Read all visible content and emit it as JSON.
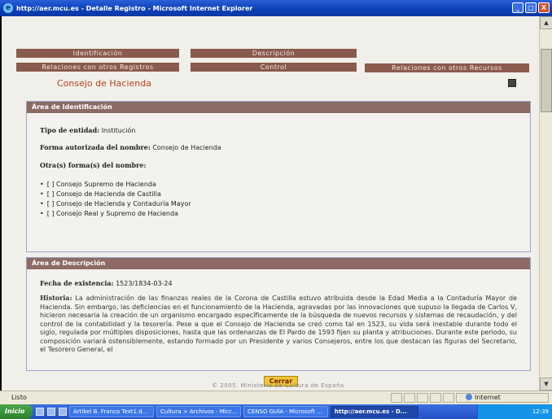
{
  "window": {
    "title": "http://aer.mcu.es - Detalle Registro - Microsoft Internet Explorer",
    "buttons": [
      "_",
      "□",
      "X"
    ]
  },
  "tabs": {
    "identificacion": "Identificación",
    "descripcion": "Descripción",
    "relaciones_registros": "Relaciones con otros Registros",
    "control": "Control",
    "relaciones_recursos": "Relaciones con otros Recursos"
  },
  "page_title": "Consejo de Hacienda",
  "identificacion": {
    "heading": "Área de Identificación",
    "tipo_label": "Tipo de entidad:",
    "tipo_value": "Institución",
    "forma_label": "Forma autorizada del nombre:",
    "forma_value": "Consejo de Hacienda",
    "otras_label": "Otra(s) forma(s) del nombre:",
    "otras": [
      "[ ] Consejo Supremo de Hacienda",
      "[ ] Consejo de Hacienda de Castilla",
      "[ ] Consejo de Hacienda y Contaduría Mayor",
      "[ ] Consejo Real y Supremo de Hacienda"
    ]
  },
  "descripcion": {
    "heading": "Área de Descripción",
    "fecha_label": "Fecha de existencia:",
    "fecha_value": "1523/1834-03-24",
    "historia_label": "Historia:",
    "historia_text": "La administración de las finanzas reales de la Corona de Castilla estuvo atribuida desde la Edad Media a la Contaduría Mayor de Hacienda. Sin embargo, las deficiencias en el funcionamiento de la Hacienda, agravadas por las innovaciones que supuso la llegada de Carlos V, hicieron necesaria la creación de un organismo encargado específicamente de la búsqueda de nuevos recursos y sistemas de recaudación, y del control de la contabilidad y la tesorería. Pese a que el Consejo de Hacienda se creó como tal en 1523, su vida será inestable durante todo el siglo, regulada por múltiples disposiciones, hasta que las ordenanzas de El Pardo de 1593 fijen su planta y atribuciones. Durante este periodo, su composición variará ostensiblemente, estando formado por un Presidente y varios Consejeros, entre los que destacan las figuras del Secretario, el Tesorero General, el"
  },
  "cerrar_label": "Cerrar",
  "footer": "© 2005. Ministerio de Cultura de España",
  "statusbar": {
    "status": "Listo",
    "zone": "Internet"
  },
  "taskbar": {
    "start": "Inicio",
    "tasks": [
      "Artikel B. Franco Text1.d...",
      "Cultura > Archivos - Micr...",
      "CENSO GUÍA - Microsoft ...",
      "http://aer.mcu.es - D..."
    ],
    "clock": "12:39"
  }
}
